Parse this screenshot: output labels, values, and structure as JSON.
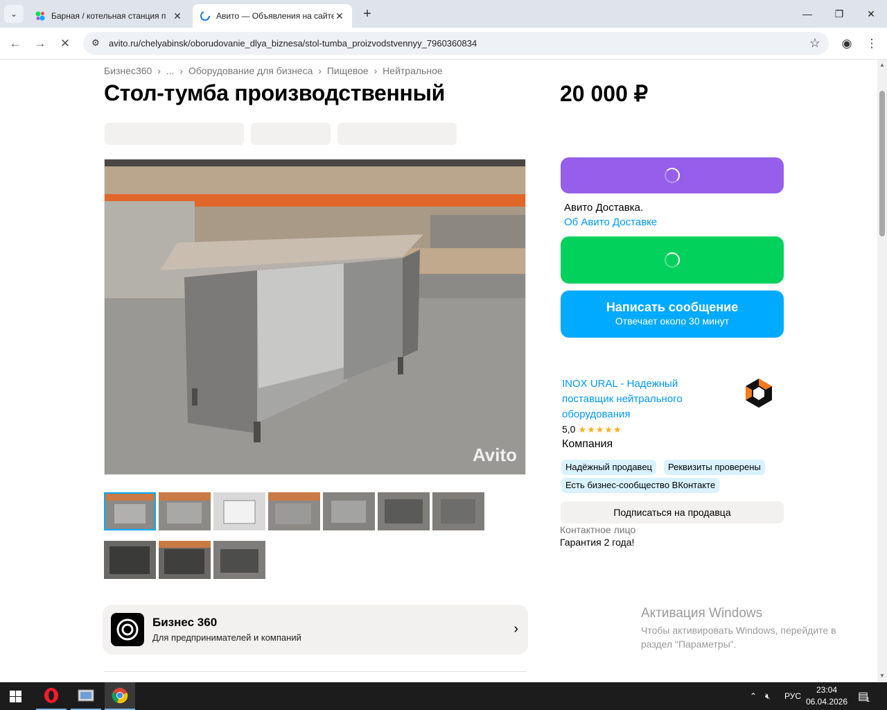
{
  "browser": {
    "tabs": [
      {
        "title": "Барная / котельная станция п",
        "active": false
      },
      {
        "title": "Авито — Объявления на сайте",
        "active": true
      }
    ],
    "url": "avito.ru/chelyabinsk/oborudovanie_dlya_biznesa/stol-tumba_proizvodstvennyy_7960360834"
  },
  "page": {
    "breadcrumbs": [
      "Бизнес360",
      "›",
      "...",
      "›",
      "Оборудование для бизнеса",
      "›",
      "Пищевое",
      "›",
      "Нейтральное"
    ],
    "title": "Стол-тумба производственный",
    "price": "20 000 ₽",
    "watermark": "Avito",
    "thumbnail_count": 10,
    "selected_thumbnail": 1,
    "business360": {
      "title": "Бизнес 360",
      "subtitle": "Для предпринимателей и компаний"
    }
  },
  "sidebar": {
    "delivery_text": "Авито Доставка.",
    "delivery_link": "Об Авито Доставке",
    "message_button": "Написать сообщение",
    "message_sub": "Отвечает около 30 минут",
    "seller_name": "INOX URAL - Надежный поставщик нейтрального оборудования",
    "rating": "5,0",
    "stars": "★★★★★",
    "seller_type": "Компания",
    "badges": [
      "Надёжный продавец",
      "Реквизиты проверены",
      "Есть бизнес-сообщество ВКонтакте"
    ],
    "subscribe": "Подписаться на продавца",
    "contact_label": "Контактное лицо",
    "guarantee": "Гарантия 2 года!"
  },
  "windows": {
    "activate_title": "Активация Windows",
    "activate_text": "Чтобы активировать Windows, перейдите в раздел \"Параметры\".",
    "lang": "РУС",
    "time": "23:04",
    "date": "06.04.2026",
    "notifications": "1"
  },
  "colors": {
    "accent_blue": "#00aaff",
    "purple": "#965eeb",
    "green": "#02d15c",
    "link": "#0099f7"
  }
}
